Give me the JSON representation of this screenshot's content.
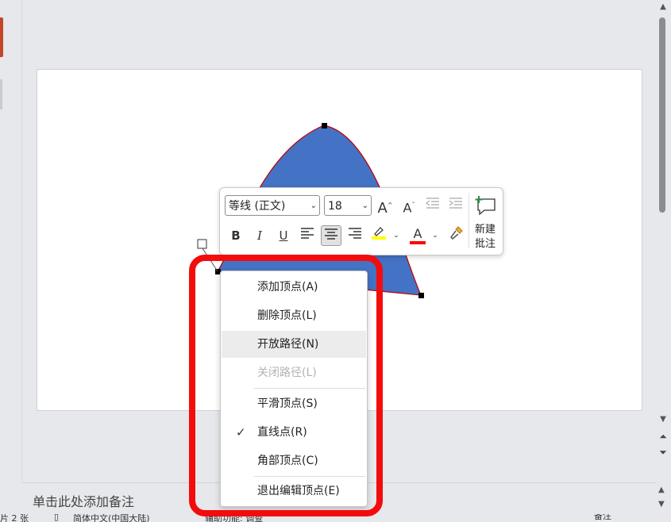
{
  "colors": {
    "shape_fill": "#4472c4",
    "shape_outline": "#c00000",
    "highlight_border": "#f40c0c",
    "highlighter_yellow": "#ffff00",
    "font_color_red": "#ff0000",
    "scroll_thumb": "#8a8c8f"
  },
  "mini_toolbar": {
    "font_name": "等线 (正文)",
    "font_size": "18",
    "icons": [
      "grow-font-icon",
      "shrink-font-icon",
      "decrease-indent-icon",
      "increase-indent-icon",
      "bold-icon",
      "italic-icon",
      "underline-icon",
      "align-left-icon",
      "align-center-icon",
      "align-right-icon",
      "highlight-color-icon",
      "font-color-icon",
      "format-painter-icon",
      "new-comment-icon"
    ],
    "bold_label": "B",
    "italic_label": "I",
    "underline_label": "U",
    "font_color_label": "A",
    "new_comment_line1": "新建",
    "new_comment_line2": "批注"
  },
  "context_menu": {
    "items": [
      {
        "label": "添加顶点(A)",
        "state": "normal"
      },
      {
        "label": "删除顶点(L)",
        "state": "normal"
      },
      {
        "label": "开放路径(N)",
        "state": "hover"
      },
      {
        "label": "关闭路径(L)",
        "state": "disabled"
      },
      {
        "label": "平滑顶点(S)",
        "state": "normal"
      },
      {
        "label": "直线点(R)",
        "state": "checked"
      },
      {
        "label": "角部顶点(C)",
        "state": "normal"
      },
      {
        "label": "退出编辑顶点(E)",
        "state": "normal"
      }
    ]
  },
  "notes": {
    "placeholder": "单击此处添加备注"
  },
  "status_bar": {
    "slide_count": "片 2 张",
    "language": "简体中文(中国大陆)",
    "accessibility": "辅助功能: 调查",
    "notes_button": "备注"
  }
}
